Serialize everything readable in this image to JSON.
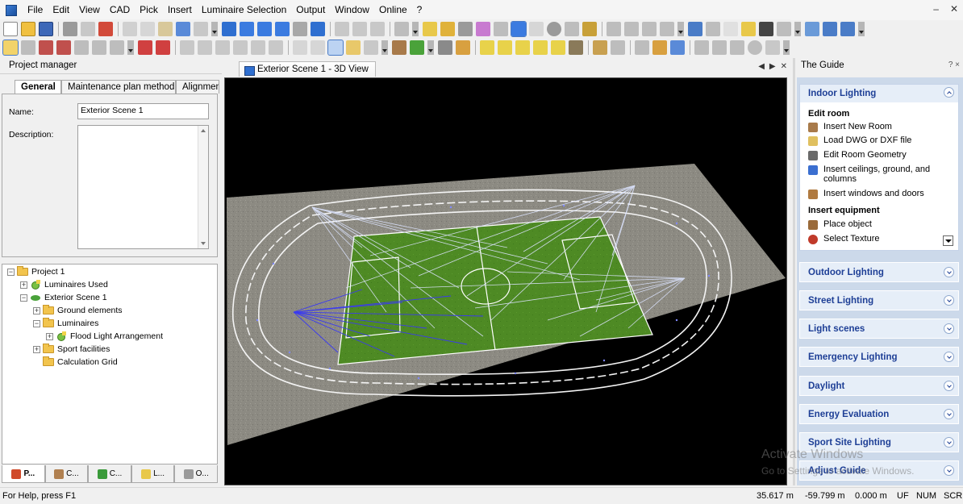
{
  "menu": {
    "items": [
      "File",
      "Edit",
      "View",
      "CAD",
      "Pick",
      "Insert",
      "Luminaire Selection",
      "Output",
      "Window",
      "Online",
      "?"
    ]
  },
  "project_manager": {
    "title": "Project manager",
    "tabs": [
      "General",
      "Maintenance plan method",
      "Alignmen"
    ],
    "name_label": "Name:",
    "name_value": "Exterior Scene 1",
    "description_label": "Description:"
  },
  "tree": {
    "project": "Project 1",
    "luminaires_used": "Luminaires Used",
    "scene": "Exterior Scene 1",
    "ground_elements": "Ground elements",
    "luminaires": "Luminaires",
    "flood_light": "Flood Light Arrangement",
    "sport_facilities": "Sport facilities",
    "calc_grid": "Calculation Grid"
  },
  "bottom_tabs": [
    "P...",
    "C...",
    "C...",
    "L...",
    "O..."
  ],
  "view": {
    "tab_label": "Exterior Scene 1 - 3D View"
  },
  "guide": {
    "title": "The Guide",
    "pin": "? ×",
    "indoor": {
      "title": "Indoor Lighting",
      "edit_room": "Edit room",
      "items_room": [
        "Insert New Room",
        "Load DWG or DXF file",
        "Edit Room Geometry",
        "Insert ceilings, ground, and columns",
        "Insert windows and doors"
      ],
      "insert_equipment": "Insert equipment",
      "items_equip": [
        "Place object",
        "Select Texture"
      ]
    },
    "sections": [
      "Outdoor Lighting",
      "Street Lighting",
      "Light scenes",
      "Emergency Lighting",
      "Daylight",
      "Energy Evaluation",
      "Sport Site Lighting",
      "Adjust Guide"
    ]
  },
  "status": {
    "help": "For Help, press F1",
    "x": "35.617 m",
    "y": "-59.799 m",
    "z": "0.000 m",
    "uf": "UF",
    "num": "NUM",
    "scrl": "SCRL"
  },
  "watermark": {
    "line1": "Activate Windows",
    "line2": "Go to Settings to activate Windows."
  },
  "colors": {
    "guide_accent": "#1e3f96",
    "field_green": "#4f8a23",
    "track_grey": "#8d8a80",
    "background_3d": "#000000"
  }
}
